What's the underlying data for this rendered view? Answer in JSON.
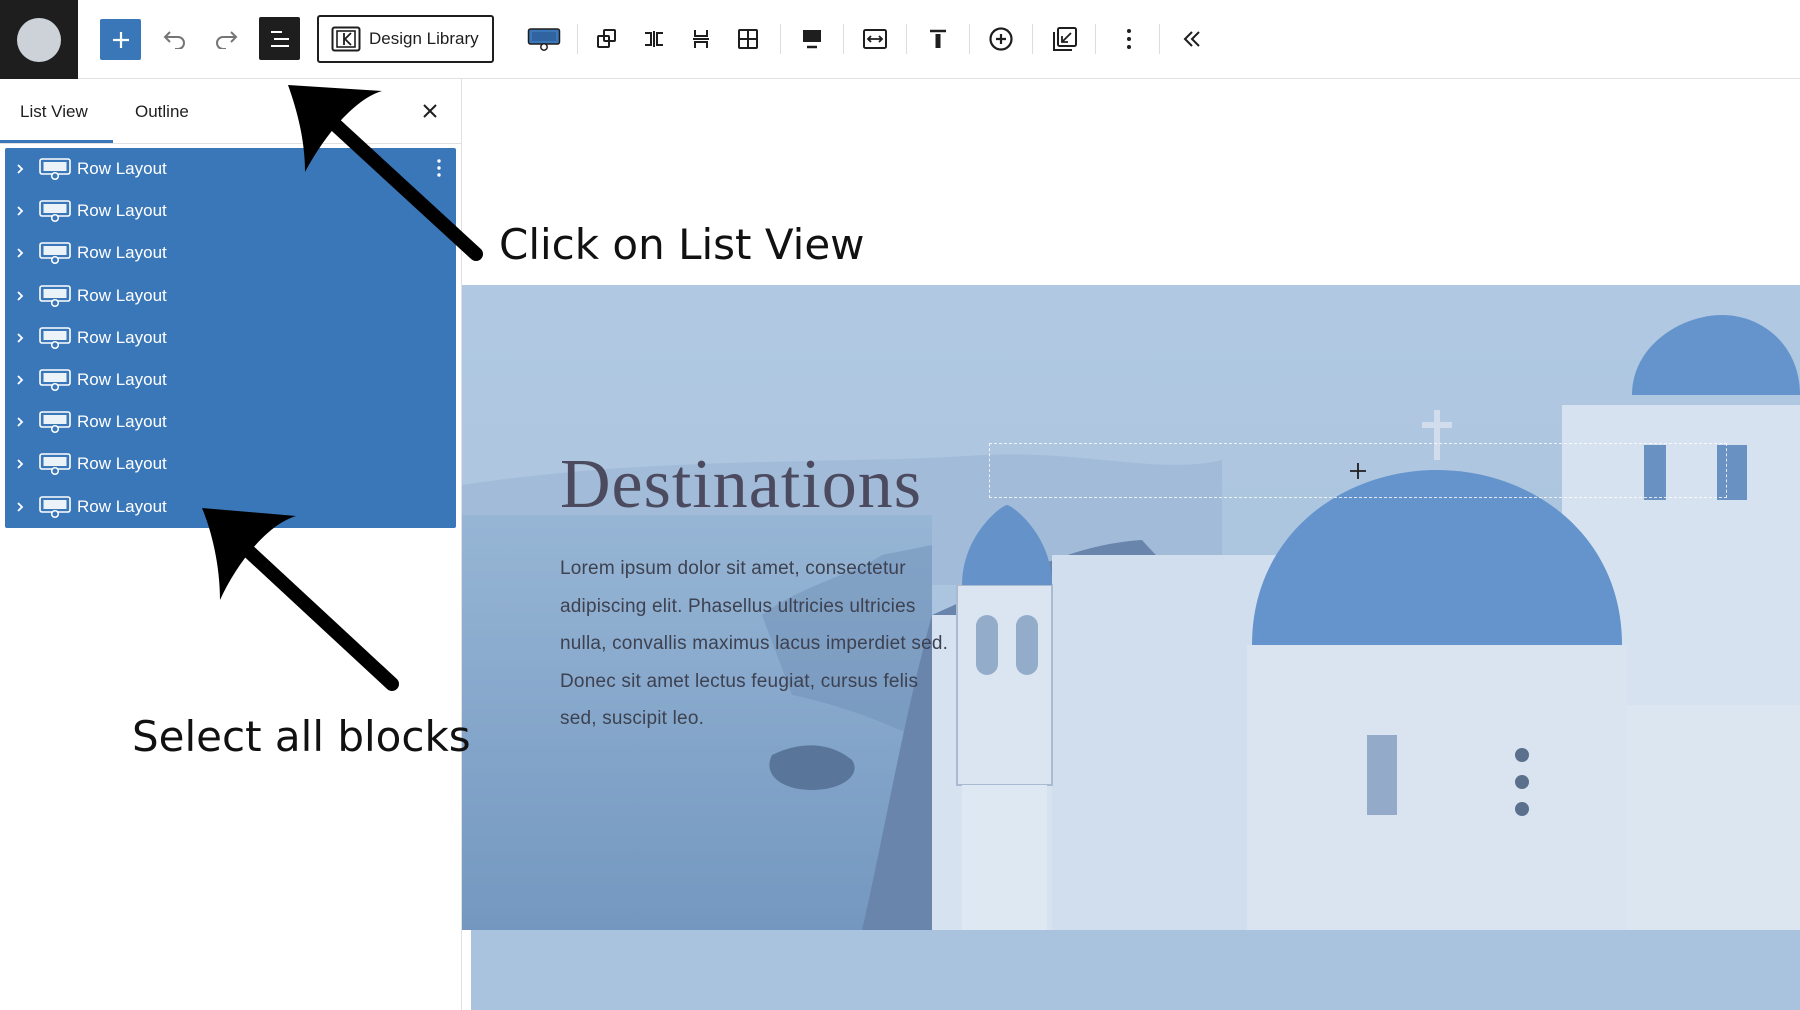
{
  "toolbar": {
    "design_library_label": "Design Library"
  },
  "panel": {
    "tabs": [
      {
        "label": "List View",
        "active": true
      },
      {
        "label": "Outline",
        "active": false
      }
    ],
    "rows": [
      {
        "label": "Row Layout"
      },
      {
        "label": "Row Layout"
      },
      {
        "label": "Row Layout"
      },
      {
        "label": "Row Layout"
      },
      {
        "label": "Row Layout"
      },
      {
        "label": "Row Layout"
      },
      {
        "label": "Row Layout"
      },
      {
        "label": "Row Layout"
      },
      {
        "label": "Row Layout"
      }
    ]
  },
  "hero": {
    "title": "Destinations",
    "body": "Lorem ipsum dolor sit amet, consectetur adipiscing elit. Phasellus ultricies ultricies nulla, convallis maximus lacus imperdiet sed. Donec sit amet lectus feugiat, cursus felis sed, suscipit leo."
  },
  "annotations": {
    "click_list_view": "Click on List View",
    "select_all_blocks": "Select all blocks"
  },
  "colors": {
    "accent": "#3a77b9",
    "dark": "#1e1e1e",
    "hero_overlay": "#a8c2dd"
  }
}
